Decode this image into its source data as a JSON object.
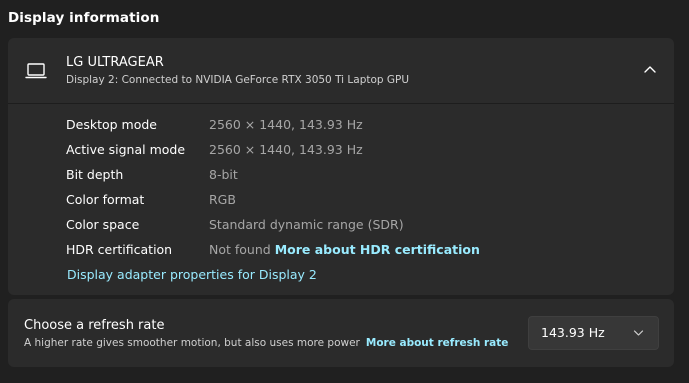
{
  "section": {
    "title": "Display information"
  },
  "display": {
    "icon": "laptop-icon",
    "name": "LG ULTRAGEAR",
    "subtitle": "Display 2: Connected to NVIDIA GeForce RTX 3050 Ti Laptop GPU",
    "collapse_icon": "chevron-up-icon",
    "info": [
      {
        "label": "Desktop mode",
        "value": "2560 × 1440, 143.93 Hz"
      },
      {
        "label": "Active signal mode",
        "value": "2560 × 1440, 143.93 Hz"
      },
      {
        "label": "Bit depth",
        "value": "8-bit"
      },
      {
        "label": "Color format",
        "value": "RGB"
      },
      {
        "label": "Color space",
        "value": "Standard dynamic range (SDR)"
      },
      {
        "label": "HDR certification",
        "value": "Not found",
        "link": "More about HDR certification"
      }
    ],
    "adapter_link": "Display adapter properties for Display 2"
  },
  "refresh": {
    "title": "Choose a refresh rate",
    "description": "A higher rate gives smoother motion, but also uses more power",
    "link": "More about refresh rate",
    "selected": "143.93 Hz",
    "dropdown_icon": "chevron-down-icon"
  },
  "colors": {
    "background": "#202020",
    "card": "#2b2b2b",
    "link": "#99ebff",
    "muted_text": "#a6a6a6"
  }
}
